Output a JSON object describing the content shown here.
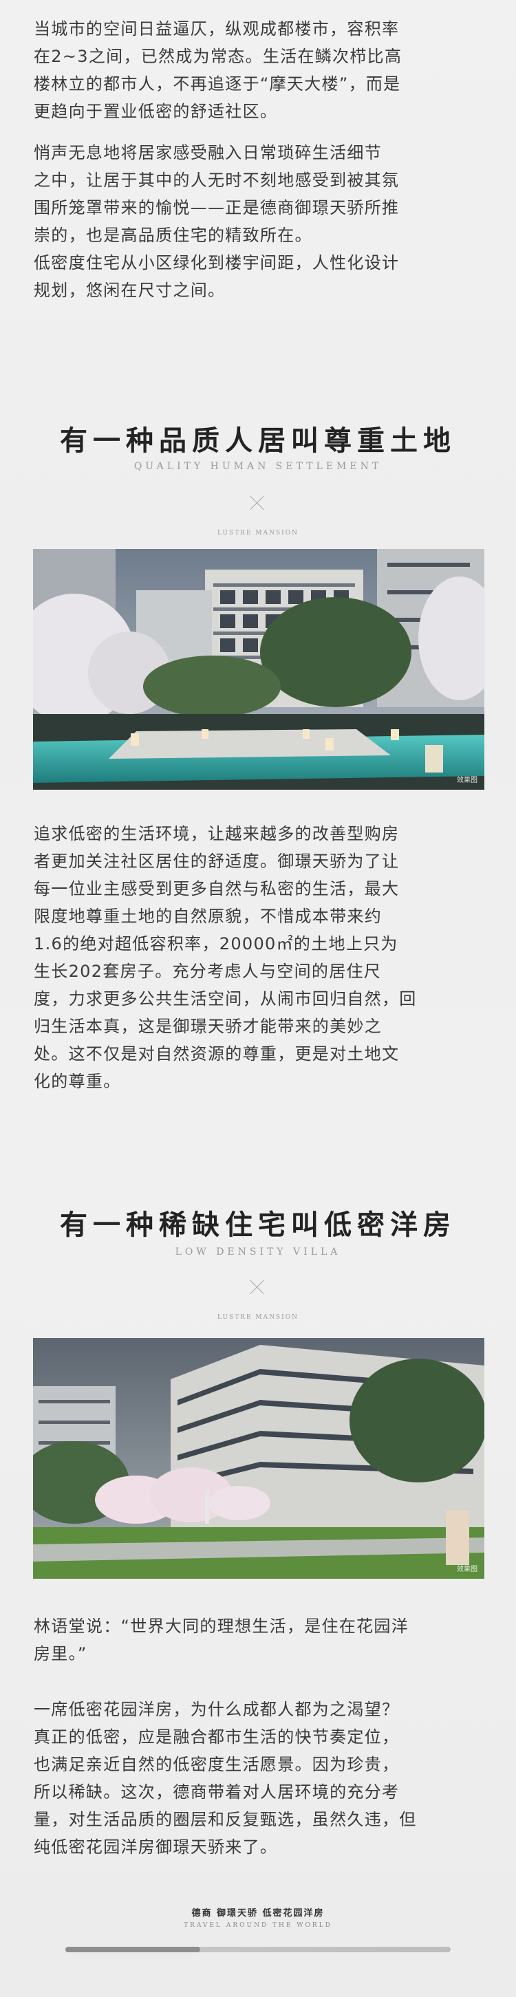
{
  "intro": {
    "p1": "当城市的空间日益逼仄，纵观成都楼市，容积率\n在2~3之间，已然成为常态。生活在鳞次栉比高\n楼林立的都市人，不再追逐于“摩天大楼”，而是\n更趋向于置业低密的舒适社区。",
    "p2": "悄声无息地将居家感受融入日常琐碎生活细节\n之中，让居于其中的人无时不刻地感受到被其氛\n围所笼罩带来的愉悦——正是德商御璟天骄所推\n崇的，也是高品质住宅的精致所在。\n低密度住宅从小区绿化到楼宇间距，人性化设计\n规划，悠闲在尺寸之间。"
  },
  "section1": {
    "title": "有一种品质人居叫尊重土地",
    "subtitle": "QUALITY HUMAN SETTLEMENT",
    "brand_mark": "LUSTRE MANSION",
    "photo_tag": "效果图",
    "body": "追求低密的生活环境，让越来越多的改善型购房\n者更加关注社区居住的舒适度。御璟天骄为了让\n每一位业主感受到更多自然与私密的生活，最大\n限度地尊重土地的自然原貌，不惜成本带来约\n1.6的绝对超低容积率，20000㎡的土地上只为\n生长202套房子。充分考虑人与空间的居住尺\n度，力求更多公共生活空间，从闹市回归自然，回\n归生活本真，这是御璟天骄才能带来的美妙之\n处。这不仅是对自然资源的尊重，更是对土地文\n化的尊重。"
  },
  "section2": {
    "title": "有一种稀缺住宅叫低密洋房",
    "subtitle": "LOW DENSITY VILLA",
    "brand_mark": "LUSTRE MANSION",
    "photo_tag": "效果图",
    "quote": "林语堂说：“世界大同的理想生活，是住在花园洋\n房里。”",
    "body": "一席低密花园洋房，为什么成都人都为之渴望？\n真正的低密，应是融合都市生活的快节奏定位，\n也满足亲近自然的低密度生活愿景。因为珍贵，\n所以稀缺。这次，德商带着对人居环境的充分考\n量，对生活品质的圈层和反复甄选，虽然久违，但\n纯低密花园洋房御璟天骄来了。"
  },
  "footer": {
    "brand": "德商 御璟天骄 低密花园洋房",
    "tagline": "TRAVEL AROUND THE WORLD",
    "scroll_progress": 0.35
  },
  "colors": {
    "background": "#efefef",
    "text": "#3a3a3a",
    "title": "#232323",
    "pool": "#3fb7b3"
  }
}
